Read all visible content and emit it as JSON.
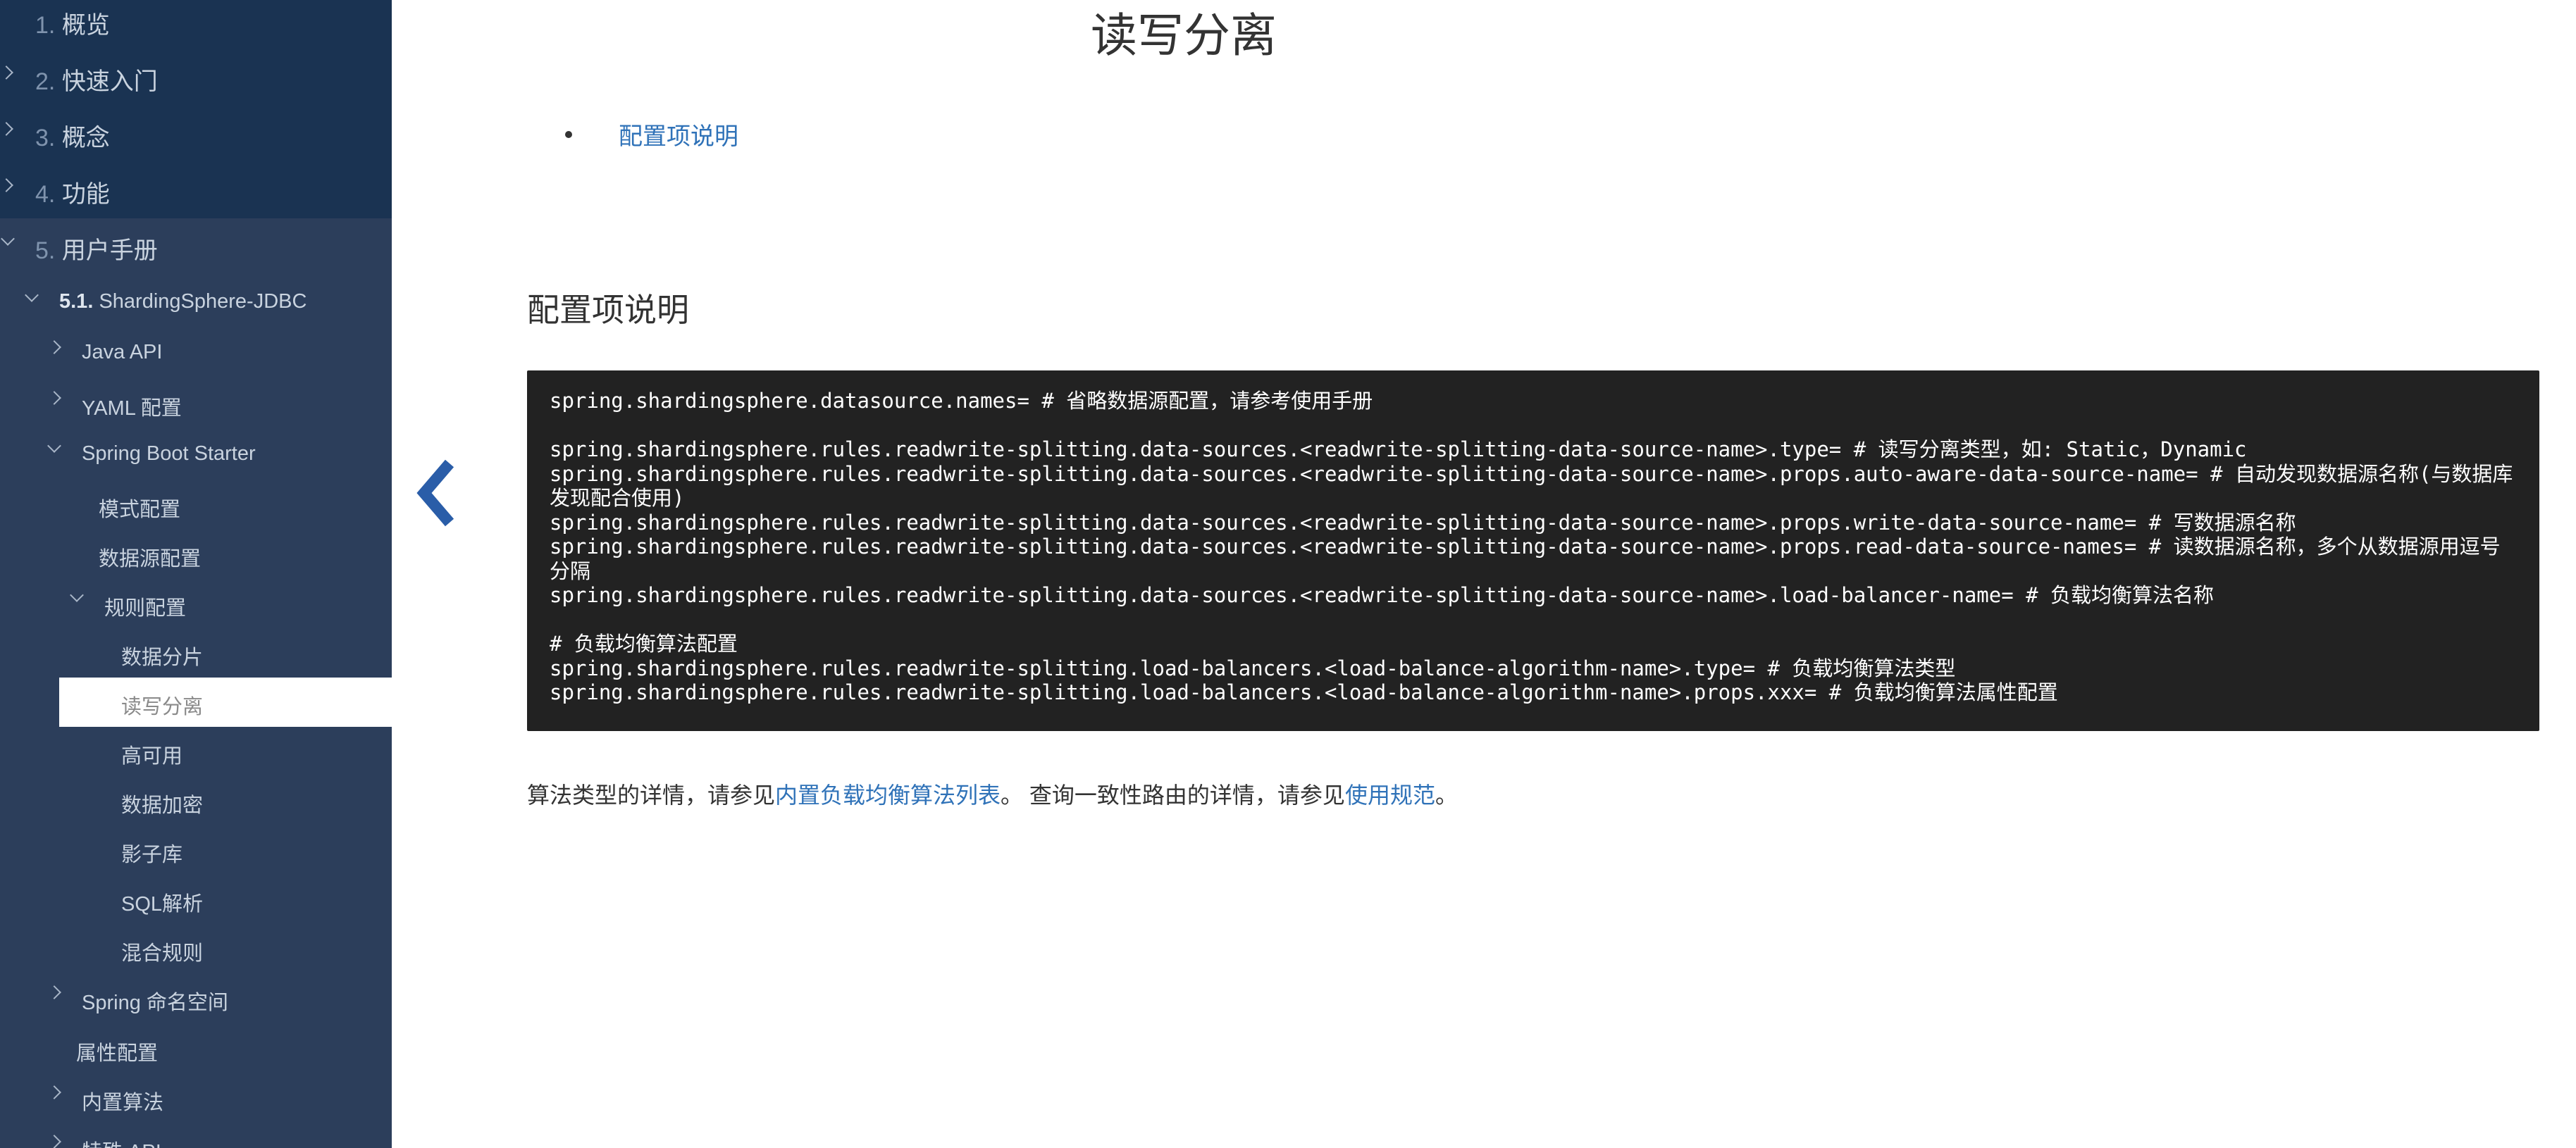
{
  "sidebar": {
    "items": [
      {
        "num": "1.",
        "label": "概览"
      },
      {
        "num": "2.",
        "label": "快速入门"
      },
      {
        "num": "3.",
        "label": "概念"
      },
      {
        "num": "4.",
        "label": "功能"
      },
      {
        "num": "5.",
        "label": "用户手册"
      },
      {
        "num": "5.1.",
        "label": "ShardingSphere-JDBC"
      },
      {
        "label": "Java API"
      },
      {
        "label": "YAML 配置"
      },
      {
        "label": "Spring Boot Starter"
      },
      {
        "label": "模式配置"
      },
      {
        "label": "数据源配置"
      },
      {
        "label": "规则配置"
      },
      {
        "label": "数据分片"
      },
      {
        "label": "读写分离"
      },
      {
        "label": "高可用"
      },
      {
        "label": "数据加密"
      },
      {
        "label": "影子库"
      },
      {
        "label": "SQL解析"
      },
      {
        "label": "混合规则"
      },
      {
        "label": "Spring 命名空间"
      },
      {
        "label": "属性配置"
      },
      {
        "label": "内置算法"
      },
      {
        "label": "特殊 API"
      }
    ]
  },
  "prev_icon": "chevron-left-icon",
  "main": {
    "title": "读写分离",
    "toc": [
      "配置项说明"
    ],
    "section_heading": "配置项说明",
    "code_lines": [
      "spring.shardingsphere.datasource.names= # 省略数据源配置，请参考使用手册",
      "",
      "spring.shardingsphere.rules.readwrite-splitting.data-sources.<readwrite-splitting-data-source-name>.type= # 读写分离类型，如: Static，Dynamic",
      "spring.shardingsphere.rules.readwrite-splitting.data-sources.<readwrite-splitting-data-source-name>.props.auto-aware-data-source-name= # 自动发现数据源名称(与数据库发现配合使用)",
      "spring.shardingsphere.rules.readwrite-splitting.data-sources.<readwrite-splitting-data-source-name>.props.write-data-source-name= # 写数据源名称",
      "spring.shardingsphere.rules.readwrite-splitting.data-sources.<readwrite-splitting-data-source-name>.props.read-data-source-names= # 读数据源名称，多个从数据源用逗号分隔",
      "spring.shardingsphere.rules.readwrite-splitting.data-sources.<readwrite-splitting-data-source-name>.load-balancer-name= # 负载均衡算法名称",
      "",
      "# 负载均衡算法配置",
      "spring.shardingsphere.rules.readwrite-splitting.load-balancers.<load-balance-algorithm-name>.type= # 负载均衡算法类型",
      "spring.shardingsphere.rules.readwrite-splitting.load-balancers.<load-balance-algorithm-name>.props.xxx= # 负载均衡算法属性配置"
    ],
    "paragraph": {
      "text1": "算法类型的详情，请参见",
      "link1": "内置负载均衡算法列表",
      "text2": "。 查询一致性路由的详情，请参见",
      "link2": "使用规范",
      "text3": "。"
    }
  },
  "colors": {
    "sidebar_bg": "#2c3e5b",
    "sidebar_top_bg": "#1a3352",
    "link": "#2f72b8",
    "code_bg": "#222222",
    "arrow": "#2a5da8"
  }
}
